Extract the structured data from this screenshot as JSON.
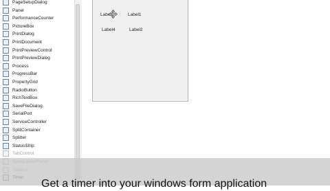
{
  "toolbox": {
    "items": [
      {
        "label": "PageSetupDialog",
        "icon": "page-setup-icon",
        "faded": false
      },
      {
        "label": "Panel",
        "icon": "panel-icon",
        "faded": false
      },
      {
        "label": "PerformanceCounter",
        "icon": "performance-counter-icon",
        "faded": false
      },
      {
        "label": "PictureBox",
        "icon": "picture-box-icon",
        "faded": false
      },
      {
        "label": "PrintDialog",
        "icon": "print-dialog-icon",
        "faded": false
      },
      {
        "label": "PrintDocument",
        "icon": "print-document-icon",
        "faded": false
      },
      {
        "label": "PrintPreviewControl",
        "icon": "print-preview-control-icon",
        "faded": false
      },
      {
        "label": "PrintPreviewDialog",
        "icon": "print-preview-dialog-icon",
        "faded": false
      },
      {
        "label": "Process",
        "icon": "process-icon",
        "faded": false
      },
      {
        "label": "ProgressBar",
        "icon": "progress-bar-icon",
        "faded": false
      },
      {
        "label": "PropertyGrid",
        "icon": "property-grid-icon",
        "faded": false
      },
      {
        "label": "RadioButton",
        "icon": "radio-button-icon",
        "faded": false
      },
      {
        "label": "RichTextBox",
        "icon": "rich-text-box-icon",
        "faded": false
      },
      {
        "label": "SaveFileDialog",
        "icon": "save-file-dialog-icon",
        "faded": false
      },
      {
        "label": "SerialPort",
        "icon": "serial-port-icon",
        "faded": false
      },
      {
        "label": "ServiceController",
        "icon": "service-controller-icon",
        "faded": false
      },
      {
        "label": "SplitContainer",
        "icon": "split-container-icon",
        "faded": false
      },
      {
        "label": "Splitter",
        "icon": "splitter-icon",
        "faded": false
      },
      {
        "label": "StatusStrip",
        "icon": "status-strip-icon",
        "faded": false
      },
      {
        "label": "TabControl",
        "icon": "tab-control-icon",
        "faded": true
      },
      {
        "label": "TableLayoutPanel",
        "icon": "table-layout-panel-icon",
        "faded": true
      },
      {
        "label": "TextBox",
        "icon": "text-box-icon",
        "faded": true
      },
      {
        "label": "Timer",
        "icon": "timer-icon",
        "faded": false
      }
    ]
  },
  "form": {
    "labels": {
      "label3": "Label3",
      "label1": "Label1",
      "label4": "Label4",
      "label2": "Label2"
    }
  },
  "caption": {
    "text": "Get a timer into your windows form application"
  }
}
